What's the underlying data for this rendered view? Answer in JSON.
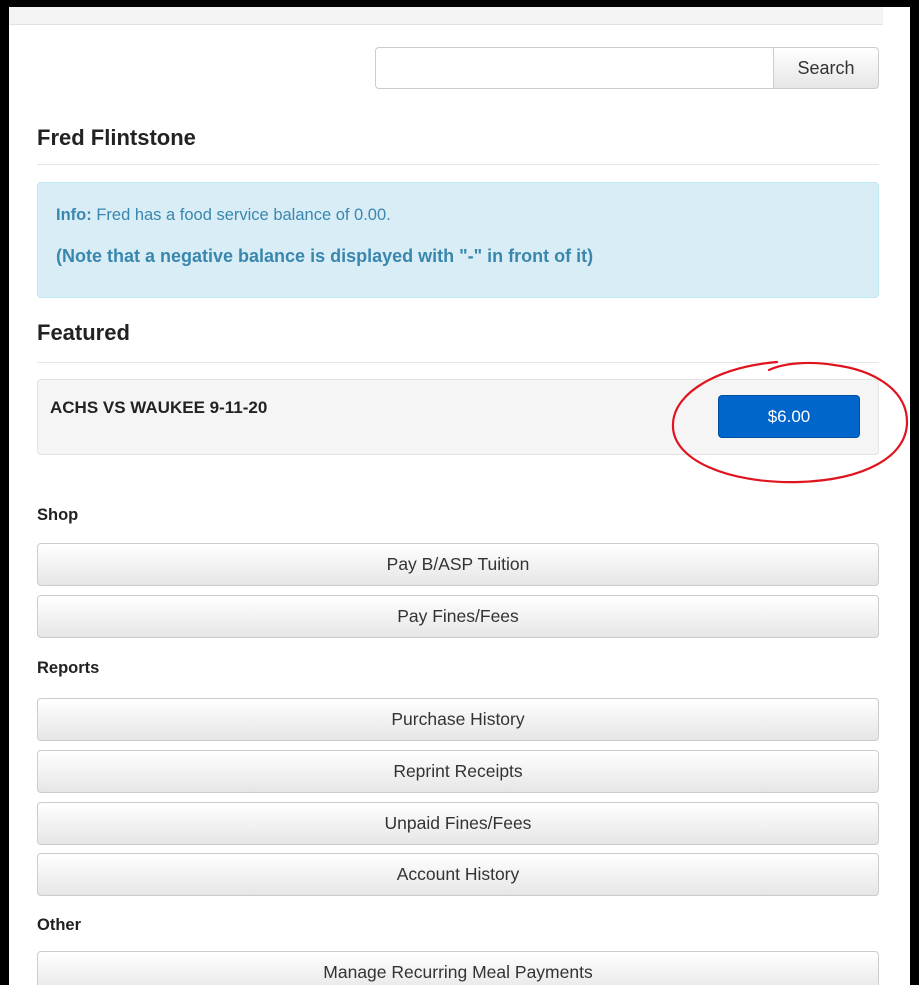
{
  "search": {
    "placeholder": "",
    "value": "",
    "button_label": "Search"
  },
  "student": {
    "name": "Fred Flintstone"
  },
  "info": {
    "label": "Info:",
    "message": " Fred has a food service balance of 0.00.",
    "note": "(Note that a negative balance is displayed with \"-\" in front of it)"
  },
  "featured": {
    "heading": "Featured",
    "item_title": "ACHS VS WAUKEE 9-11-20",
    "price": "$6.00",
    "annotation_color": "#e0141e"
  },
  "sections": {
    "shop": {
      "label": "Shop",
      "items": [
        "Pay B/ASP Tuition",
        "Pay Fines/Fees"
      ]
    },
    "reports": {
      "label": "Reports",
      "items": [
        "Purchase History",
        "Reprint Receipts",
        "Unpaid Fines/Fees",
        "Account History"
      ]
    },
    "other": {
      "label": "Other",
      "items": [
        "Manage Recurring Meal Payments"
      ]
    }
  },
  "colors": {
    "primary_button": "#0066cc",
    "info_text": "#3a87ad",
    "info_background": "#d9edf7"
  }
}
